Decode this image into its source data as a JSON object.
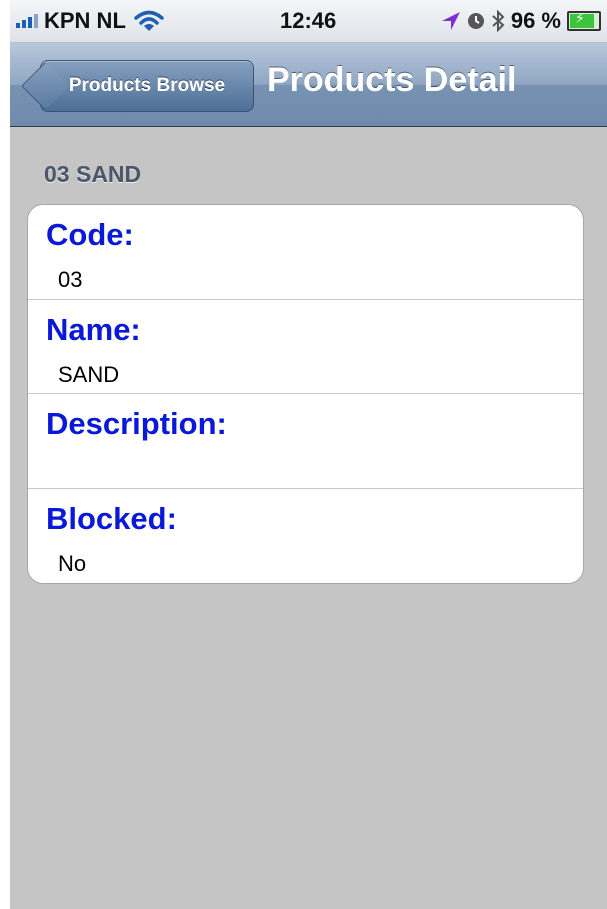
{
  "status_bar": {
    "carrier": "KPN NL",
    "time": "12:46",
    "battery_percent": "96 %",
    "icons": [
      "signal-icon",
      "wifi-icon",
      "location-arrow-icon",
      "alarm-clock-icon",
      "bluetooth-icon",
      "battery-charging-icon"
    ],
    "location_icon_color": "#7b2fd6"
  },
  "nav_bar": {
    "back_label": "Products Browse",
    "title": "Products Detail"
  },
  "content": {
    "section_header": "03 SAND",
    "fields": [
      {
        "label": "Code:",
        "value": "03"
      },
      {
        "label": "Name:",
        "value": "SAND"
      },
      {
        "label": "Description:",
        "value": ""
      },
      {
        "label": "Blocked:",
        "value": "No"
      }
    ],
    "label_color": "#0a18d8"
  }
}
